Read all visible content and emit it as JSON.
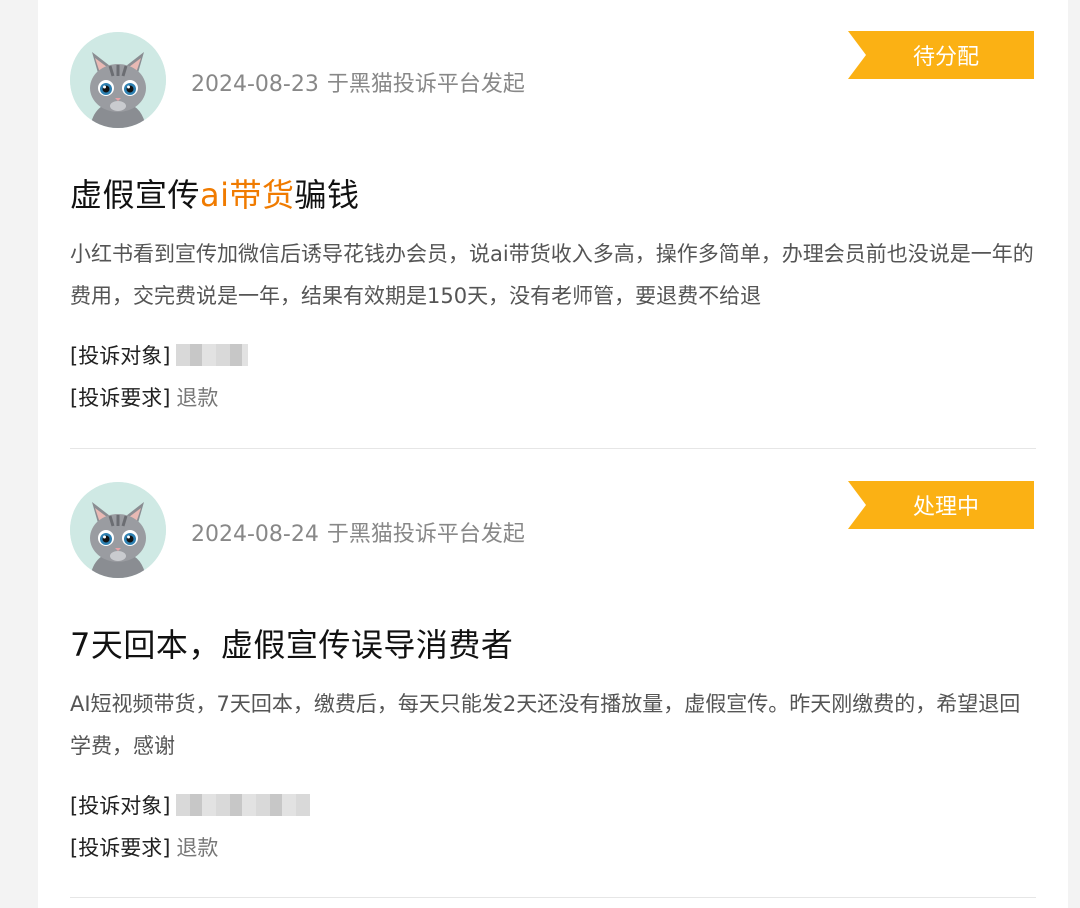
{
  "complaints": [
    {
      "date": "2024-08-23",
      "source": "于黑猫投诉平台发起",
      "status": "待分配",
      "title_parts": [
        "虚假宣传",
        "ai带货",
        "骗钱"
      ],
      "description": "小红书看到宣传加微信后诱导花钱办会员，说ai带货收入多高，操作多简单，办理会员前也没说是一年的费用，交完费说是一年，结果有效期是150天，没有老师管，要退费不给退",
      "target_label": "[投诉对象]",
      "request_label": "[投诉要求]",
      "request_value": "退款"
    },
    {
      "date": "2024-08-24",
      "source": "于黑猫投诉平台发起",
      "status": "处理中",
      "title": "7天回本，虚假宣传误导消费者",
      "description": "AI短视频带货，7天回本，缴费后，每天只能发2天还没有播放量，虚假宣传。昨天刚缴费的，希望退回学费，感谢",
      "target_label": "[投诉对象]",
      "request_label": "[投诉要求]",
      "request_value": "退款"
    }
  ],
  "colors": {
    "status_badge": "#fbb114",
    "title_highlight": "#f07b00",
    "avatar_bg": "#cfe9e4"
  }
}
